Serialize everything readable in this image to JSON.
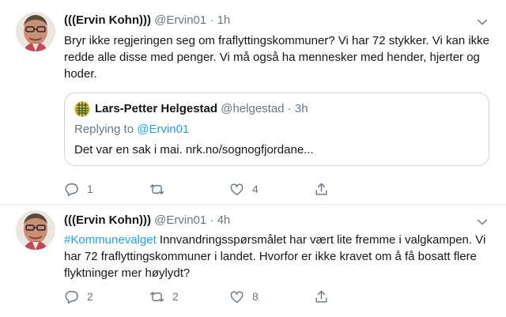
{
  "tweets": [
    {
      "display_name": "(((Ervin Kohn)))",
      "handle": "@Ervin01",
      "separator": "·",
      "time": "1h",
      "text": "Bryr ikke regjeringen seg om fraflyttingskommuner? Vi har 72 stykker. Vi kan ikke redde alle disse med penger. Vi må også ha mennesker med hender, hjerter og hoder.",
      "quote": {
        "display_name": "Lars-Petter Helgestad",
        "handle": "@helgestad",
        "separator": "·",
        "time": "3h",
        "replying_prefix": "Replying to ",
        "replying_to": "@Ervin01",
        "text": "Det var en sak i mai. nrk.no/sognogfjordane..."
      },
      "replies": "1",
      "retweets": "",
      "likes": "4"
    },
    {
      "display_name": "(((Ervin Kohn)))",
      "handle": "@Ervin01",
      "separator": "·",
      "time": "4h",
      "hashtag": "#Kommunevalget",
      "text": " Innvandringsspørsmålet har vært lite fremme i valgkampen. Vi har 72 fraflyttingskommuner i landet. Hvorfor er ikke kravet om å få bosatt flere flyktninger mer høylydt?",
      "replies": "2",
      "retweets": "2",
      "likes": "8"
    }
  ],
  "colors": {
    "accent": "#1da1f2",
    "muted": "#657786",
    "text": "#14171a",
    "divider": "#e6ecf0"
  },
  "icons": [
    "chevron-down-icon",
    "reply-icon",
    "retweet-icon",
    "like-icon",
    "share-icon"
  ]
}
